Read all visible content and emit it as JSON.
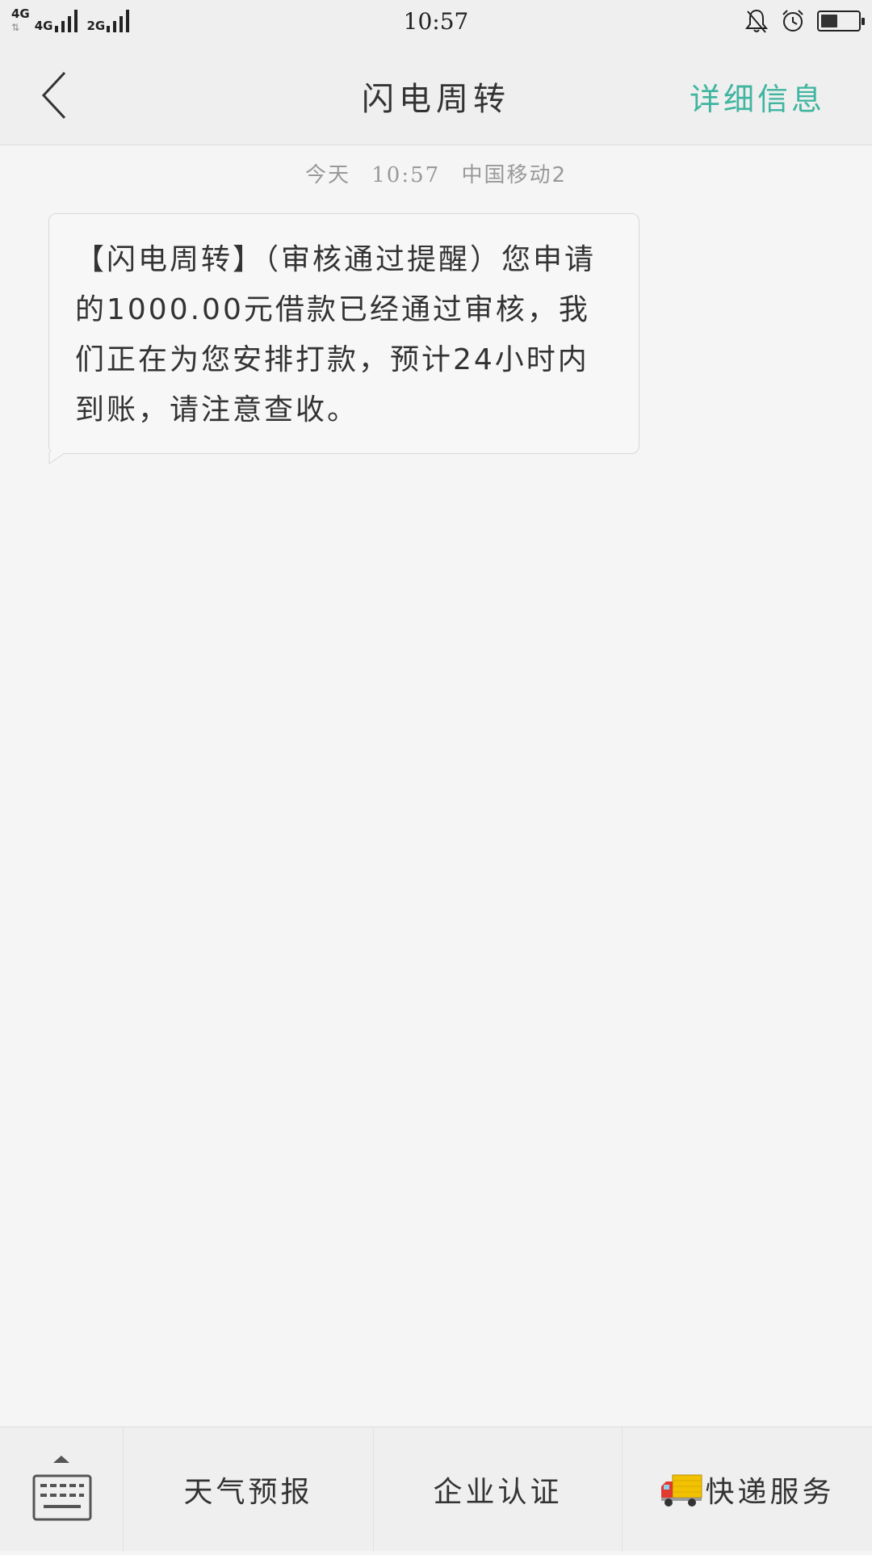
{
  "status_bar": {
    "network_1": "4G",
    "network_2": "4G",
    "network_3": "2G",
    "data_arrows": "⇅",
    "time": "10:57",
    "icons": [
      "bell-off-icon",
      "alarm-icon",
      "battery-icon"
    ],
    "battery_level": 0.45
  },
  "header": {
    "back_icon": "chevron-left-icon",
    "title": "闪电周转",
    "detail_label": "详细信息",
    "accent_color": "#3fb5a0"
  },
  "conversation": {
    "meta": {
      "day": "今天",
      "time": "10:57",
      "carrier": "中国移动2"
    },
    "messages": [
      {
        "text": "【闪电周转】（审核通过提醒）您申请的1000.00元借款已经通过审核，我们正在为您安排打款，预计24小时内到账，请注意查收。"
      }
    ]
  },
  "bottom_menu": {
    "keyboard_icon": "keyboard-icon",
    "items": [
      {
        "label": "天气预报"
      },
      {
        "label": "企业认证"
      },
      {
        "label": "快递服务",
        "icon": "delivery-truck-icon"
      }
    ]
  }
}
